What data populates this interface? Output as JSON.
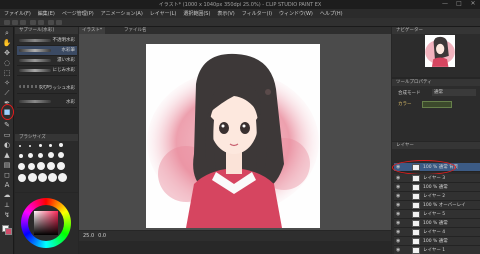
{
  "window": {
    "title": "イラスト* (1000 x 1040px 350dpi 25.0%) - CLIP STUDIO PAINT EX",
    "controls": [
      "—",
      "□",
      "✕"
    ]
  },
  "menu": [
    "ファイル(F)",
    "編集(E)",
    "ページ管理(P)",
    "アニメーション(A)",
    "レイヤー(L)",
    "選択範囲(S)",
    "表示(V)",
    "フィルター(I)",
    "ウィンドウ(W)",
    "ヘルプ(H)"
  ],
  "tools": [
    "search-icon",
    "hand-icon",
    "move-icon",
    "lasso-icon",
    "wand-icon",
    "eyedropper-icon",
    "pen-icon",
    "pencil-icon",
    "brush-icon",
    "airbrush-icon",
    "eraser-icon",
    "blend-icon",
    "fill-icon",
    "gradient-icon",
    "shape-icon",
    "text-icon",
    "balloon-icon",
    "ruler-icon",
    "fill-color-icon"
  ],
  "subtool": {
    "header": "サブツール[水彩]",
    "brushes": [
      {
        "label": "不透明水彩",
        "color": "#6f6f6f"
      },
      {
        "label": "水彩筆",
        "color": "#7b7b7b"
      },
      {
        "label": "濃い水彩",
        "color": "#8d8d8d"
      },
      {
        "label": "にじみ水彩",
        "color": "#a0a0a0"
      },
      {
        "label": "スプラッシュ水彩",
        "color": "#9a9a9a"
      },
      {
        "label": "水彩",
        "color": "#8a8a8a"
      }
    ]
  },
  "brushsize": {
    "header": "ブラシサイズ"
  },
  "color": {
    "main": "#d8d8d8",
    "sub": "#ffffff"
  },
  "tabs": [
    "イラスト*",
    "ファイル名"
  ],
  "canvas": {
    "accent": "#e87b8e",
    "sweater": "#d64560",
    "hair": "#3d3838"
  },
  "status": [
    "25.0",
    "0.0"
  ],
  "navigator": {
    "header": "ナビゲーター"
  },
  "property": {
    "header": "ツールプロパティ",
    "blend_label": "合成モード",
    "blend_value": "通常",
    "color_label": "カラー"
  },
  "layers": {
    "header": "レイヤー",
    "items": [
      {
        "name": "100 % 通常\n背景",
        "highlighted": true
      },
      {
        "name": "レイヤー 3"
      },
      {
        "name": "100 % 通常"
      },
      {
        "name": "レイヤー 2"
      },
      {
        "name": "100 % オーバーレイ"
      },
      {
        "name": "レイヤー 5"
      },
      {
        "name": "100 % 通常"
      },
      {
        "name": "レイヤー 4"
      },
      {
        "name": "100 % 通常"
      },
      {
        "name": "レイヤー 1"
      }
    ]
  }
}
